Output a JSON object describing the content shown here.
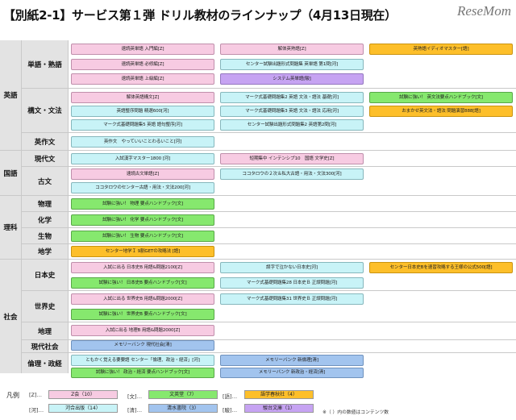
{
  "title": "【別紙2-1】サービス第１弾 ドリル教材のラインナップ（4月13日現在）",
  "logo": "ReseMom",
  "colors": {
    "z": "#f7cbe2",
    "bunshin": "#86e86e",
    "shogakusha": "#fdbf2a",
    "kawai": "#c8f3f7",
    "shimizu": "#a2c4ee",
    "sundai": "#c6a3f2"
  },
  "subjects": {
    "english": "英語",
    "kokugo": "国語",
    "rika": "理科",
    "shakai": "社会"
  },
  "categories": {
    "tango": "単語・熟語",
    "kobun_bunpo": "構文・文法",
    "eisakubun": "英作文",
    "gendaibun": "現代文",
    "kobun": "古文",
    "butsuri": "物理",
    "kagaku": "化学",
    "seibutsu": "生物",
    "chigaku": "地学",
    "nihonshi": "日本史",
    "sekaishi": "世界史",
    "chiri": "地理",
    "gendai_shakai": "現代社会",
    "rinri": "倫理・政経"
  },
  "items": {
    "e1": "速読英単語 入門編[Z]",
    "e2": "解体英熟語[Z]",
    "e3": "英熟語イディオマスター[語]",
    "e4": "速読英単語 必修編[Z]",
    "e5": "センター試験出題形式問題集 英単語 第1問[河]",
    "e6": "速読英単語 上級編[Z]",
    "e7": "システム英単語[駿]",
    "e8": "解体英語構文[Z]",
    "e9": "マーク式基礎問題集2 英語 文法・語法 基礎[河]",
    "e10": "試験に強い！ 英文法要点ハンドブック[文]",
    "e11": "英語整序問題 精選600[河]",
    "e12": "マーク式基礎問題集3 英語 文法・語法 応用[河]",
    "e13": "おまかせ英文法・語法 問題演習888[語]",
    "e14": "マーク式基礎問題集5 英語 語句整序[河]",
    "e15": "センター試験出題形式問題集2 英語第2問[河]",
    "e16": "英作文　やっていいことわるいこと[河]",
    "k1": "入試漢字マスター1800 [河]",
    "k2": "短期集中 インテンシブ10　国語 文学史[Z]",
    "k3": "速読古文単語[Z]",
    "k4": "ココタロウの２次＆私大古語・用法・文法300[河]",
    "k5": "ココタロウのセンター古語・用法・文法200[河]",
    "r1": "試験に強い！ 物理 要点ハンドブック[文]",
    "r2": "試験に強い！ 化学 要点ハンドブック[文]",
    "r3": "試験に強い！ 生物 要点ハンドブック[文]",
    "r4": "センター地学Ｉ 9割GETの攻略法 [語]",
    "s1": "入試に出る 日本史B 用語&問題2100[Z]",
    "s2": "誤字で泣かない日本史[河]",
    "s3": "センター日本史Bを速習攻略する王様の公式500[語]",
    "s4": "試験に強い！ 日本史B 要点ハンドブック[文]",
    "s5": "マーク式基礎問題集28 日本史Ｂ 正誤問題[河]",
    "s6": "入試に出る 世界史B 用語&問題2000[Z]",
    "s7": "マーク式基礎問題集31 世界史Ｂ 正誤問題[河]",
    "s8": "試験に強い！ 世界史B 要点ハンドブック[文]",
    "s9": "入試に出る 地理B 用語&問題2000[Z]",
    "s10": "メモリーバンク 現代社会[清]",
    "s11": "ともかく覚える要要語 センター「倫理、政治・経済」[河]",
    "s12": "メモリーバンク 新倫理[清]",
    "s13": "試験に強い！ 政治・経済 要点ハンドブック[文]",
    "s14": "メモリーバンク 新政治・経済[清]"
  },
  "legend": {
    "label": "凡例",
    "codes": {
      "z": "[Z]…",
      "bun": "[文]…",
      "go": "[語]…",
      "ka": "[河]…",
      "sei": "[清]…",
      "sun": "[駿]…"
    },
    "names": {
      "z": "Z会（10）",
      "bun": "文英堂（7）",
      "go": "語学春秋社（4）",
      "ka": "河合出版（14）",
      "sei": "清水書院（3）",
      "sun": "駿台文庫（1）"
    },
    "note": "※（ ）内の数値はコンテンツ数"
  }
}
